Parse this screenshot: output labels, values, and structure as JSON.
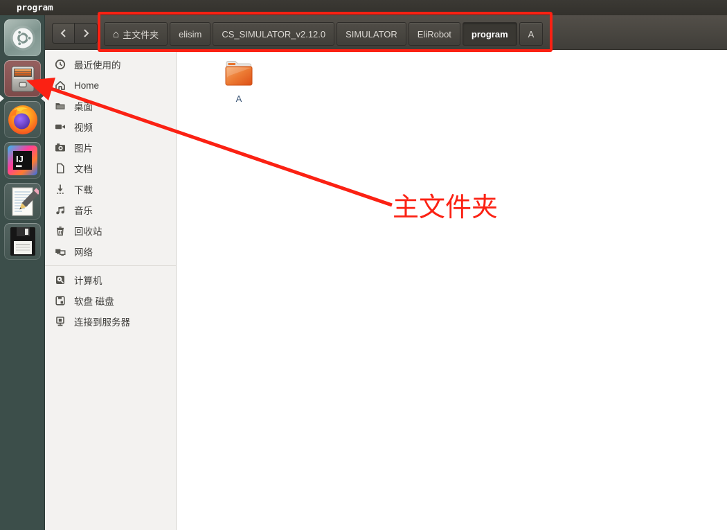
{
  "window": {
    "title": "program"
  },
  "dock": {
    "items": [
      {
        "id": "ubuntu-dash",
        "label": "Ubuntu Dash"
      },
      {
        "id": "files",
        "label": "Files",
        "active": true
      },
      {
        "id": "firefox",
        "label": "Firefox"
      },
      {
        "id": "intellij-idea",
        "label": "IntelliJ IDEA"
      },
      {
        "id": "text-editor",
        "label": "Text Editor"
      },
      {
        "id": "floppy-disk",
        "label": "Disk"
      }
    ]
  },
  "toolbar": {
    "back_label": "后退",
    "forward_label": "前进",
    "breadcrumbs": [
      {
        "label": "主文件夹",
        "icon": "home",
        "current": false
      },
      {
        "label": "elisim",
        "current": false
      },
      {
        "label": "CS_SIMULATOR_v2.12.0",
        "current": false
      },
      {
        "label": "SIMULATOR",
        "current": false
      },
      {
        "label": "EliRobot",
        "current": false
      },
      {
        "label": "program",
        "current": true
      },
      {
        "label": "A",
        "current": false
      }
    ]
  },
  "sidebar": {
    "places": [
      {
        "label": "最近使用的",
        "icon": "clock-icon"
      },
      {
        "label": "Home",
        "icon": "home-icon"
      },
      {
        "label": "桌面",
        "icon": "desktop-folder-icon"
      },
      {
        "label": "视频",
        "icon": "video-camera-icon"
      },
      {
        "label": "图片",
        "icon": "photo-camera-icon"
      },
      {
        "label": "文档",
        "icon": "document-icon"
      },
      {
        "label": "下载",
        "icon": "download-arrow-icon"
      },
      {
        "label": "音乐",
        "icon": "music-notes-icon"
      },
      {
        "label": "回收站",
        "icon": "trash-icon"
      },
      {
        "label": "网络",
        "icon": "network-icon"
      }
    ],
    "devices": [
      {
        "label": "计算机",
        "icon": "harddisk-icon"
      },
      {
        "label": "软盘 磁盘",
        "icon": "floppy-icon"
      },
      {
        "label": "连接到服务器",
        "icon": "server-icon"
      }
    ]
  },
  "main": {
    "items": [
      {
        "label": "A",
        "type": "folder"
      }
    ]
  },
  "annotation": {
    "callout": "主文件夹"
  },
  "colors": {
    "annotation-red": "#fb2113",
    "dock-bg": "#3c4e4a",
    "headerbar-top": "#534f49",
    "headerbar-bottom": "#403e39",
    "sidebar-bg": "#f3f2f0",
    "files-active-tile": "#7c4a49",
    "folder-orange": "#e2601f"
  }
}
